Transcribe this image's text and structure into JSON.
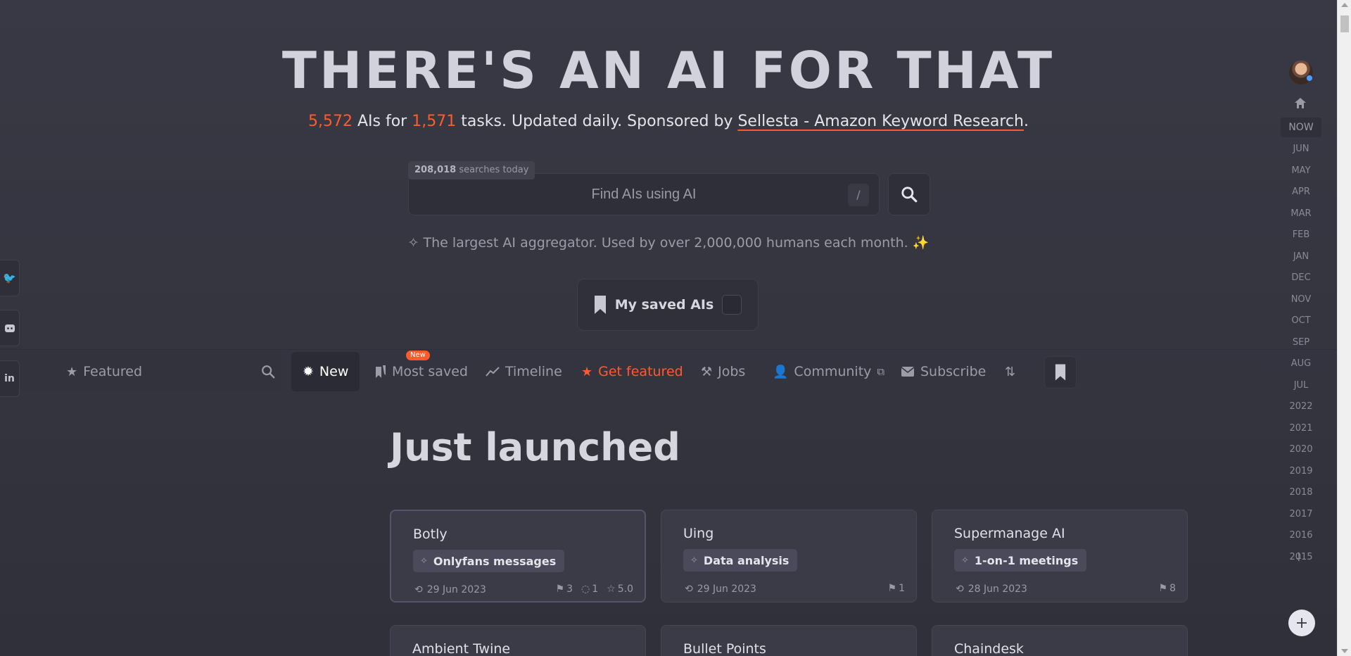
{
  "header": {
    "title": "THERE'S AN AI FOR THAT",
    "ai_count": "5,572",
    "ais_for": "AIs for",
    "task_count": "1,571",
    "tasks_text": "tasks. Updated daily. Sponsored by",
    "sponsor": "Sellesta - Amazon Keyword Research",
    "period": "."
  },
  "search": {
    "badge_count": "208,018",
    "badge_text": "searches today",
    "placeholder": "Find AIs using AI",
    "shortcut": "/"
  },
  "tagline": "The largest AI aggregator. Used by over 2,000,000 humans each month.",
  "saved": {
    "label": "My saved AIs"
  },
  "nav": {
    "featured": "Featured",
    "new": "New",
    "most_saved": "Most saved",
    "most_saved_badge": "New",
    "timeline": "Timeline",
    "get_featured": "Get featured",
    "jobs": "Jobs",
    "community": "Community",
    "subscribe": "Subscribe"
  },
  "main": {
    "section_title": "Just launched",
    "cards": [
      {
        "name": "Botly",
        "tag": "Onlyfans messages",
        "date": "29 Jun 2023",
        "saves": "3",
        "comments": "1",
        "rating": "5.0"
      },
      {
        "name": "Uing",
        "tag": "Data analysis",
        "date": "29 Jun 2023",
        "saves": "1"
      },
      {
        "name": "Supermanage AI",
        "tag": "1-on-1 meetings",
        "date": "28 Jun 2023",
        "saves": "8"
      }
    ],
    "cards_row2": [
      {
        "name": "Ambient Twine"
      },
      {
        "name": "Bullet Points"
      },
      {
        "name": "Chaindesk"
      }
    ]
  },
  "timeline": {
    "now": "NOW",
    "items": [
      "JUN",
      "MAY",
      "APR",
      "MAR",
      "FEB",
      "JAN",
      "DEC",
      "NOV",
      "OCT",
      "SEP",
      "AUG",
      "JUL",
      "2022",
      "2021",
      "2020",
      "2019",
      "2018",
      "2017",
      "2016",
      "2015"
    ]
  },
  "colors": {
    "accent": "#ff5a2c",
    "bg": "#363641",
    "card": "#3b3b48"
  }
}
